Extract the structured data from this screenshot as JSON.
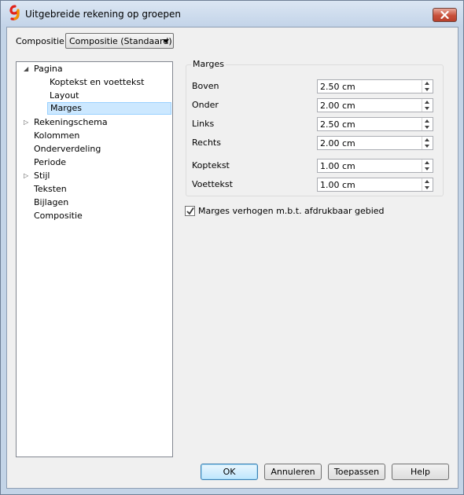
{
  "window": {
    "title": "Uitgebreide rekening op groepen"
  },
  "composition": {
    "label": "Compositie:",
    "selected": "Compositie (Standaard)"
  },
  "tree": {
    "items": [
      {
        "label": "Pagina",
        "expander": "expanded"
      },
      {
        "label": "Koptekst en voettekst"
      },
      {
        "label": "Layout"
      },
      {
        "label": "Marges",
        "selected": true
      },
      {
        "label": "Rekeningschema",
        "expander": "collapsed"
      },
      {
        "label": "Kolommen"
      },
      {
        "label": "Onderverdeling"
      },
      {
        "label": "Periode"
      },
      {
        "label": "Stijl",
        "expander": "collapsed"
      },
      {
        "label": "Teksten"
      },
      {
        "label": "Bijlagen"
      },
      {
        "label": "Compositie"
      }
    ]
  },
  "margins": {
    "title": "Marges",
    "fields": [
      {
        "label": "Boven",
        "value": "2.50 cm"
      },
      {
        "label": "Onder",
        "value": "2.00 cm"
      },
      {
        "label": "Links",
        "value": "2.50 cm"
      },
      {
        "label": "Rechts",
        "value": "2.00 cm"
      },
      {
        "label": "Koptekst",
        "value": "1.00 cm"
      },
      {
        "label": "Voettekst",
        "value": "1.00 cm"
      }
    ]
  },
  "increase_margins": {
    "label": "Marges verhogen m.b.t. afdrukbaar gebied",
    "checked": true
  },
  "buttons": {
    "ok": "OK",
    "cancel": "Annuleren",
    "apply": "Toepassen",
    "help": "Help"
  },
  "colors": {
    "selection": "#cce8ff",
    "close": "#c8503a",
    "accent": "#3c7fb1"
  }
}
